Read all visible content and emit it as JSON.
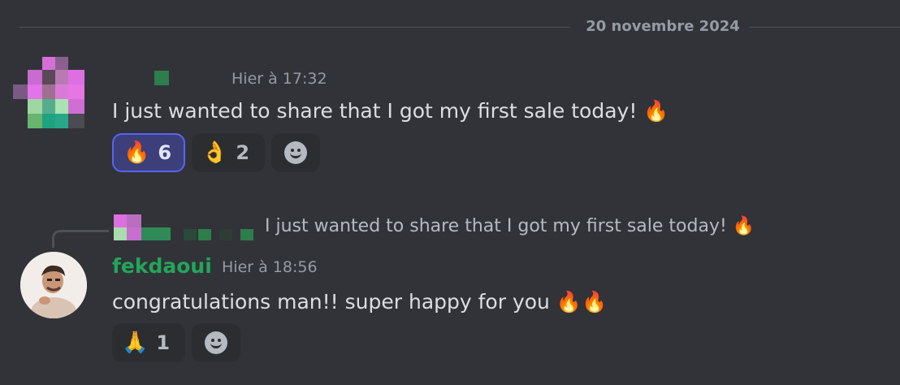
{
  "divider": {
    "date": "20 novembre 2024"
  },
  "message1": {
    "timestamp": "Hier à 17:32",
    "text": "I just wanted to share that I got my first sale today! 🔥",
    "reactions": [
      {
        "emoji": "🔥",
        "count": "6",
        "active": true
      },
      {
        "emoji": "👌",
        "count": "2",
        "active": false
      }
    ],
    "add_reaction_icon": "smiley-add-icon"
  },
  "message2": {
    "reply_preview": "I just wanted to share that I got my first sale today! 🔥",
    "username": "fekdaoui",
    "timestamp": "Hier à 18:56",
    "text": "congratulations man!! super happy for you 🔥🔥",
    "reactions": [
      {
        "emoji": "🙏",
        "count": "1",
        "active": false
      }
    ],
    "add_reaction_icon": "smiley-add-icon"
  },
  "colors": {
    "background": "#313338",
    "username": "#23a55a",
    "active_reaction_border": "#5865f2",
    "muted_text": "#949ba4"
  }
}
